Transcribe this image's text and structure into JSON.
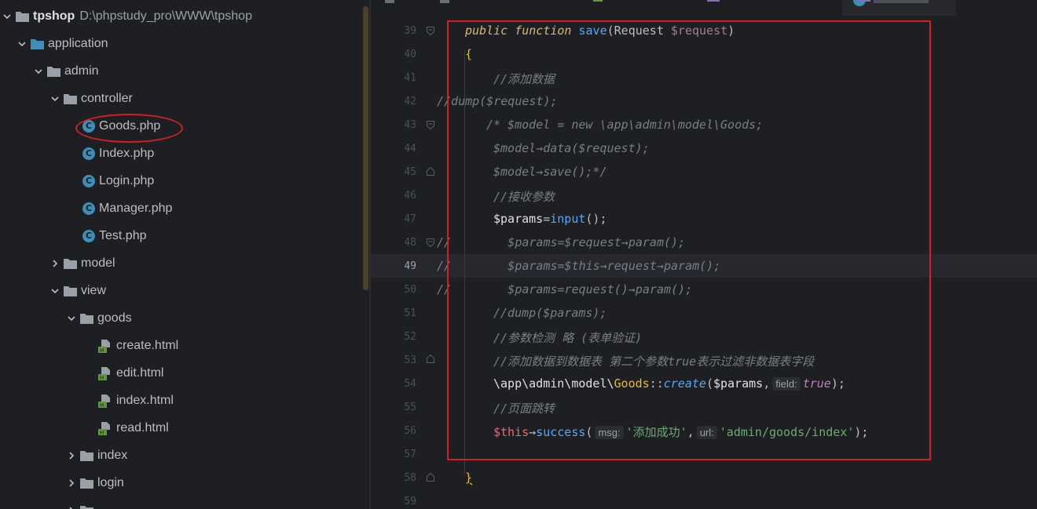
{
  "project": {
    "root_name": "tpshop",
    "root_path": "D:\\phpstudy_pro\\WWW\\tpshop",
    "items": [
      {
        "label": "application"
      },
      {
        "label": "admin"
      },
      {
        "label": "controller"
      },
      {
        "label": "Goods.php"
      },
      {
        "label": "Index.php"
      },
      {
        "label": "Login.php"
      },
      {
        "label": "Manager.php"
      },
      {
        "label": "Test.php"
      },
      {
        "label": "model"
      },
      {
        "label": "view"
      },
      {
        "label": "goods"
      },
      {
        "label": "create.html"
      },
      {
        "label": "edit.html"
      },
      {
        "label": "index.html"
      },
      {
        "label": "read.html"
      },
      {
        "label": "index"
      },
      {
        "label": "login"
      }
    ]
  },
  "editor": {
    "current_line": "49",
    "line_numbers": [
      "39",
      "40",
      "41",
      "42",
      "43",
      "44",
      "45",
      "46",
      "47",
      "48",
      "49",
      "50",
      "51",
      "52",
      "53",
      "54",
      "55",
      "56",
      "57",
      "58",
      "59"
    ],
    "code": {
      "l39_public": "public",
      "l39_function": "function",
      "l39_name": "save",
      "l39_type": "Request",
      "l39_param": "$request",
      "l40": "{",
      "l41": "//添加数据",
      "l42": "//dump($request);",
      "l43": "/* $model = new \\app\\admin\\model\\Goods;",
      "l44": "$model→data($request);",
      "l45": "$model→save();*/",
      "l46": "//接收参数",
      "l47_var": "$params",
      "l47_fn": "input",
      "l48": "//        $params=$request→param();",
      "l49": "//        $params=$this→request→param();",
      "l50": "//        $params=request()→param();",
      "l51": "//dump($params);",
      "l52": "//参数检测 略 (表单验证)",
      "l53": "//添加数据到数据表 第二个参数true表示过滤非数据表字段",
      "l54_ns": "\\app\\admin\\model\\",
      "l54_cls": "Goods",
      "l54_fn": "create",
      "l54_var": "$params",
      "l54_hint": "field:",
      "l54_bool": "true",
      "l55": "//页面跳转",
      "l56_this": "$this",
      "l56_fn": "success",
      "l56_hint1": "msg:",
      "l56_str1": "'添加成功'",
      "l56_hint2": "url:",
      "l56_str2": "'admin/goods/index'",
      "l58": "}"
    }
  },
  "annotations": {
    "color": "#d01f2a"
  }
}
